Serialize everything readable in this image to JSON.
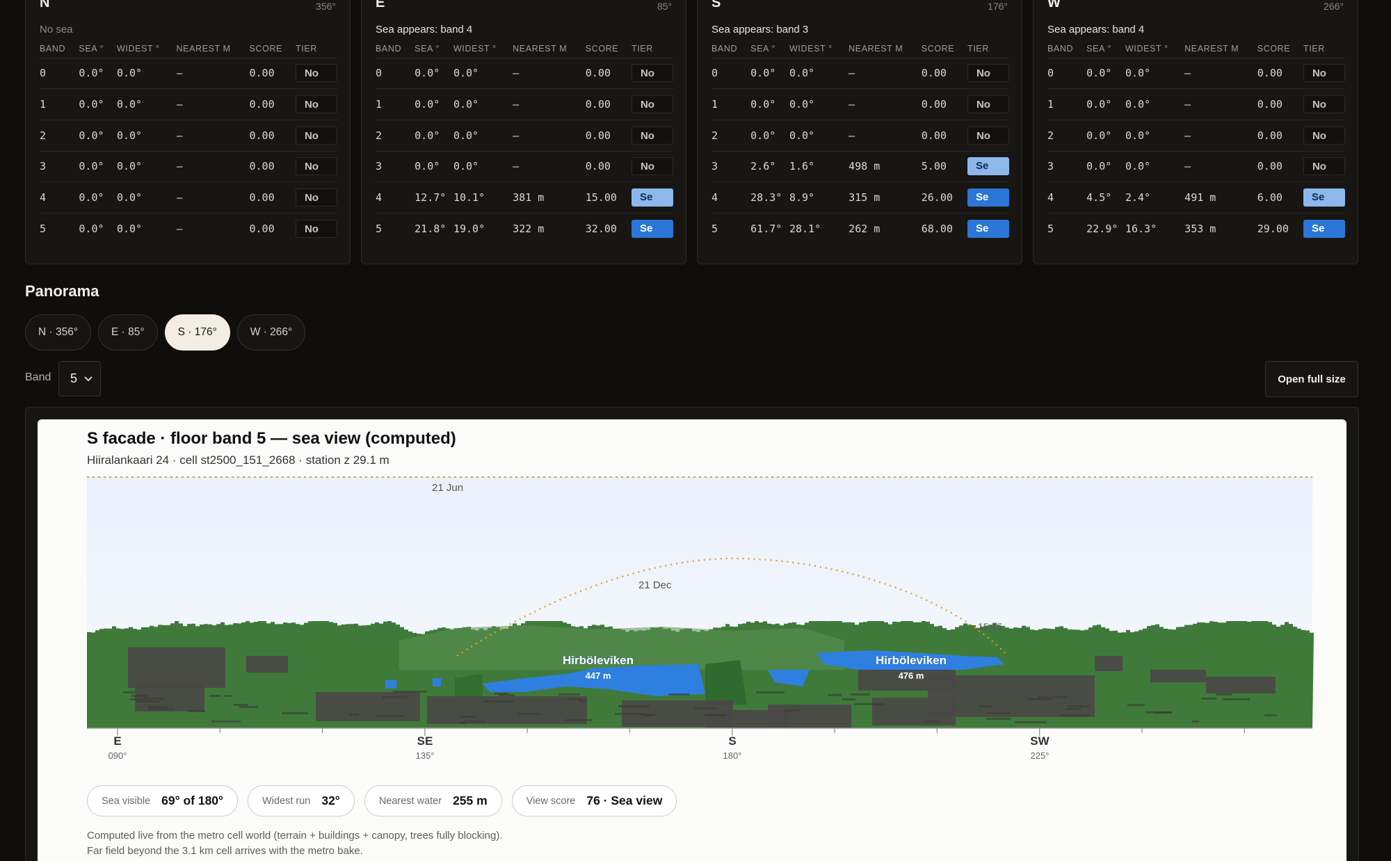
{
  "columns": [
    "BAND",
    "SEA °",
    "WIDEST °",
    "NEAREST M",
    "SCORE",
    "TIER"
  ],
  "facades": [
    {
      "letter": "N",
      "deg": "356°",
      "status": "No sea",
      "muted": true,
      "rows": [
        [
          "0",
          "0.0°",
          "0.0°",
          "—",
          "0.00",
          "No",
          "no"
        ],
        [
          "1",
          "0.0°",
          "0.0°",
          "—",
          "0.00",
          "No",
          "no"
        ],
        [
          "2",
          "0.0°",
          "0.0°",
          "—",
          "0.00",
          "No",
          "no"
        ],
        [
          "3",
          "0.0°",
          "0.0°",
          "—",
          "0.00",
          "No",
          "no"
        ],
        [
          "4",
          "0.0°",
          "0.0°",
          "—",
          "0.00",
          "No",
          "no"
        ],
        [
          "5",
          "0.0°",
          "0.0°",
          "—",
          "0.00",
          "No",
          "no"
        ]
      ]
    },
    {
      "letter": "E",
      "deg": "85°",
      "status": "Sea appears: band 4",
      "muted": false,
      "rows": [
        [
          "0",
          "0.0°",
          "0.0°",
          "—",
          "0.00",
          "No",
          "no"
        ],
        [
          "1",
          "0.0°",
          "0.0°",
          "—",
          "0.00",
          "No",
          "no"
        ],
        [
          "2",
          "0.0°",
          "0.0°",
          "—",
          "0.00",
          "No",
          "no"
        ],
        [
          "3",
          "0.0°",
          "0.0°",
          "—",
          "0.00",
          "No",
          "no"
        ],
        [
          "4",
          "12.7°",
          "10.1°",
          "381 m",
          "15.00",
          "Se",
          "light"
        ],
        [
          "5",
          "21.8°",
          "19.0°",
          "322 m",
          "32.00",
          "Se",
          "strong"
        ]
      ]
    },
    {
      "letter": "S",
      "deg": "176°",
      "status": "Sea appears: band 3",
      "muted": false,
      "rows": [
        [
          "0",
          "0.0°",
          "0.0°",
          "—",
          "0.00",
          "No",
          "no"
        ],
        [
          "1",
          "0.0°",
          "0.0°",
          "—",
          "0.00",
          "No",
          "no"
        ],
        [
          "2",
          "0.0°",
          "0.0°",
          "—",
          "0.00",
          "No",
          "no"
        ],
        [
          "3",
          "2.6°",
          "1.6°",
          "498 m",
          "5.00",
          "Se",
          "light"
        ],
        [
          "4",
          "28.3°",
          "8.9°",
          "315 m",
          "26.00",
          "Se",
          "strong"
        ],
        [
          "5",
          "61.7°",
          "28.1°",
          "262 m",
          "68.00",
          "Se",
          "strong"
        ]
      ]
    },
    {
      "letter": "W",
      "deg": "266°",
      "status": "Sea appears: band 4",
      "muted": false,
      "rows": [
        [
          "0",
          "0.0°",
          "0.0°",
          "—",
          "0.00",
          "No",
          "no"
        ],
        [
          "1",
          "0.0°",
          "0.0°",
          "—",
          "0.00",
          "No",
          "no"
        ],
        [
          "2",
          "0.0°",
          "0.0°",
          "—",
          "0.00",
          "No",
          "no"
        ],
        [
          "3",
          "0.0°",
          "0.0°",
          "—",
          "0.00",
          "No",
          "no"
        ],
        [
          "4",
          "4.5°",
          "2.4°",
          "491 m",
          "6.00",
          "Se",
          "light"
        ],
        [
          "5",
          "22.9°",
          "16.3°",
          "353 m",
          "29.00",
          "Se",
          "strong"
        ]
      ]
    }
  ],
  "panorama": {
    "section_title": "Panorama",
    "tabs": [
      "N · 356°",
      "E · 85°",
      "S · 176°",
      "W · 266°"
    ],
    "active_tab": 2,
    "band_label": "Band",
    "band_value": "5",
    "open_button": "Open full size",
    "title": "S facade · floor band 5 — sea view (computed)",
    "subtitle": "Hiiralankaari 24 · cell st2500_151_2668 · station z 29.1 m",
    "sun_labels": {
      "summer": "21 Jun",
      "winter": "21 Dec",
      "time": "15:15"
    },
    "water_labels": [
      {
        "name": "Hirböleviken",
        "dist": "447 m"
      },
      {
        "name": "Hirböleviken",
        "dist": "476 m"
      }
    ],
    "compass": [
      {
        "dir": "E",
        "deg": "090°"
      },
      {
        "dir": "SE",
        "deg": "135°"
      },
      {
        "dir": "S",
        "deg": "180°"
      },
      {
        "dir": "SW",
        "deg": "225°"
      }
    ],
    "metrics": [
      {
        "label": "Sea visible",
        "value": "69° of 180°"
      },
      {
        "label": "Widest run",
        "value": "32°"
      },
      {
        "label": "Nearest water",
        "value": "255 m"
      },
      {
        "label": "View score",
        "value": "76 · Sea view"
      }
    ],
    "note_line1": "Computed live from the metro cell world (terrain + buildings + canopy, trees fully blocking).",
    "note_line2": "Far field beyond the 3.1 km cell arrives with the metro bake.",
    "colors": {
      "sky_top": "#eaf1fb",
      "terrain": "#3f7a3a",
      "building": "#4a4846",
      "water": "#2f7fe0",
      "sun_path": "#e0a020"
    }
  }
}
